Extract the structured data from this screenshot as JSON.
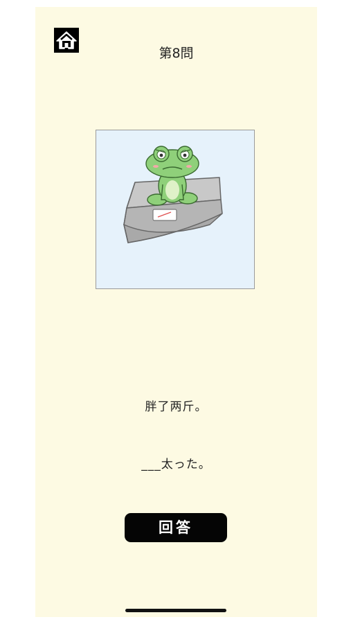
{
  "header": {
    "home_icon": "home-icon",
    "question_number": "第8問"
  },
  "illustration": {
    "subject": "frog-on-scale-image"
  },
  "prompt": {
    "chinese": "胖了两斤。",
    "japanese": "___太った。"
  },
  "actions": {
    "answer_label": "回答"
  },
  "colors": {
    "background": "#fdfae3",
    "image_bg": "#e6f2fb",
    "button": "#050505",
    "frog": "#8fd07a"
  }
}
